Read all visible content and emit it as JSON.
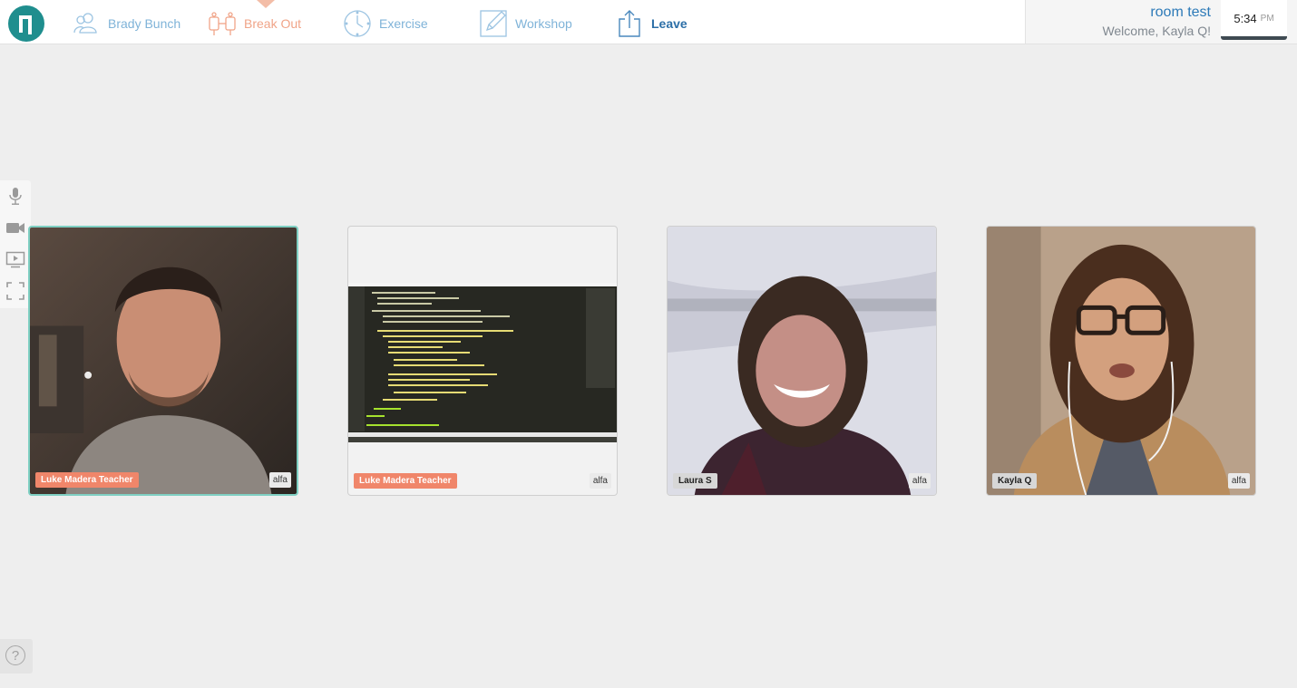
{
  "nav": {
    "items": [
      {
        "label": "Brady Bunch",
        "icon": "people-icon"
      },
      {
        "label": "Break Out",
        "icon": "breakout-icon"
      },
      {
        "label": "Exercise",
        "icon": "clock-icon"
      },
      {
        "label": "Workshop",
        "icon": "edit-icon"
      },
      {
        "label": "Leave",
        "icon": "share-exit-icon"
      }
    ],
    "active": "Break Out"
  },
  "room": {
    "name": "room test",
    "welcome": "Welcome, Kayla Q!"
  },
  "clock": {
    "time": "5:34",
    "ampm": "PM"
  },
  "side_tools": [
    "microphone-icon",
    "camera-icon",
    "screen-share-icon",
    "fullscreen-icon"
  ],
  "help": {
    "label": "?"
  },
  "tiles": [
    {
      "name": "Luke Madera Teacher",
      "badge": "alfa",
      "role": "teacher"
    },
    {
      "name": "Luke Madera Teacher",
      "badge": "alfa",
      "role": "teacher"
    },
    {
      "name": "Laura S",
      "badge": "alfa",
      "role": "student"
    },
    {
      "name": "Kayla Q",
      "badge": "alfa",
      "role": "student"
    }
  ],
  "colors": {
    "brand": "#1f8e8e",
    "nav_link": "#7fb3d8",
    "nav_active": "#f0a488",
    "teacher_tag": "#f0866a",
    "speaking_border": "#7fd0c3"
  }
}
